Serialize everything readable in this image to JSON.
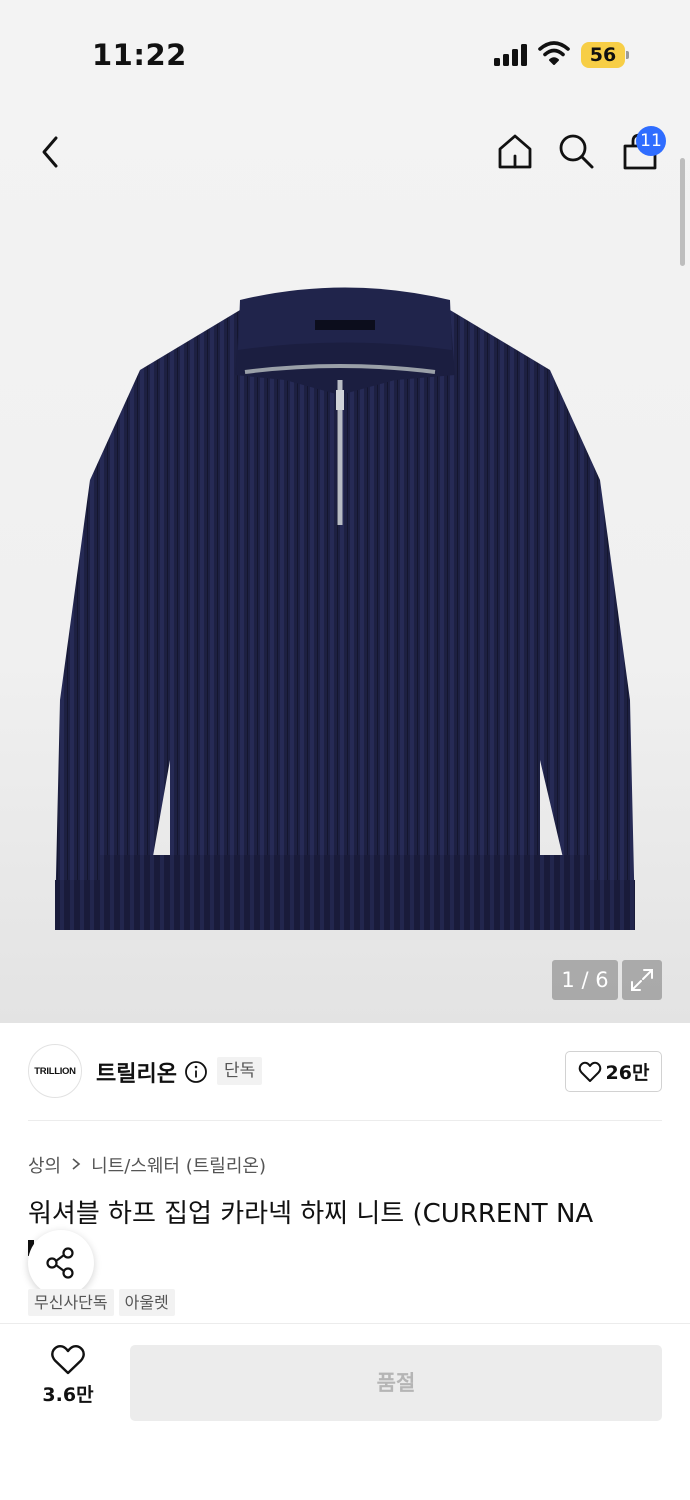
{
  "status_bar": {
    "time": "11:22",
    "battery_level": "56",
    "battery_color": "#f7ce46"
  },
  "header": {
    "back_icon": "chevron-left-icon",
    "home_icon": "home-icon",
    "search_icon": "search-icon",
    "cart_icon": "shopping-bag-icon",
    "cart_badge": "11",
    "badge_color": "#2f6dff"
  },
  "gallery": {
    "counter": "1 / 6",
    "expand_icon": "expand-icon",
    "product_color": "#1d2042"
  },
  "brand": {
    "logo_text": "TRILLION",
    "name": "트릴리온",
    "info_icon": "info-icon",
    "exclusive_tag": "단독",
    "like_count": "26만"
  },
  "breadcrumb": {
    "category": "상의",
    "subcategory": "니트/스웨터 (트릴리온)"
  },
  "product": {
    "title": "워셔블 하프 집업 카라넥 하찌 니트 (CURRENT NA",
    "tags": [
      "무신사단독",
      "아울렛"
    ]
  },
  "bottom_bar": {
    "wish_count": "3.6만",
    "soldout_label": "품절"
  }
}
